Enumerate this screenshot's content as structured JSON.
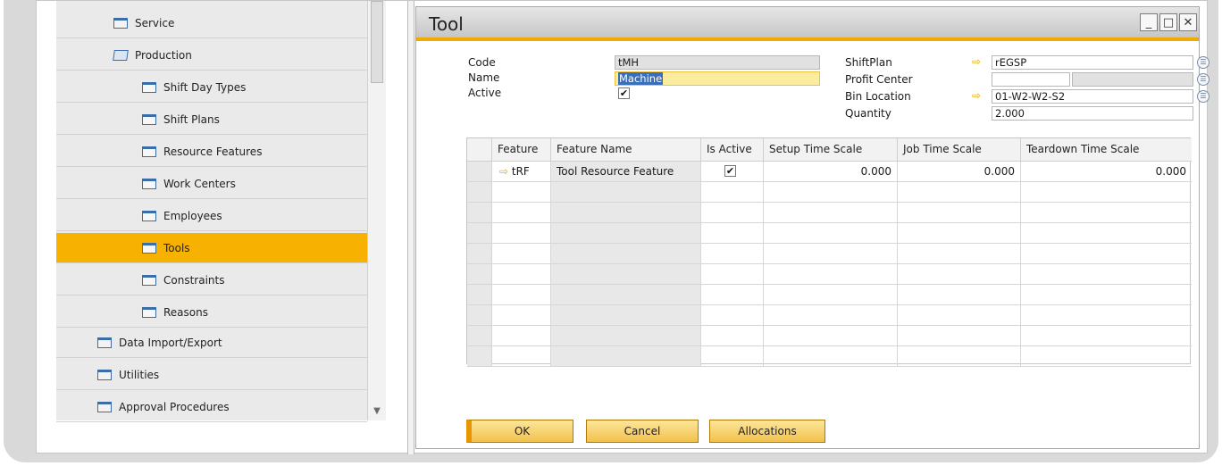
{
  "nav": {
    "items": [
      {
        "label": "Service",
        "icon": "folder-icon",
        "indent": 1,
        "selected": false
      },
      {
        "label": "Production",
        "icon": "folder-open-icon",
        "indent": 1,
        "selected": false
      },
      {
        "label": "Shift Day Types",
        "icon": "window-icon",
        "indent": 2,
        "selected": false
      },
      {
        "label": "Shift Plans",
        "icon": "window-icon",
        "indent": 2,
        "selected": false
      },
      {
        "label": "Resource Features",
        "icon": "window-icon",
        "indent": 2,
        "selected": false
      },
      {
        "label": "Work Centers",
        "icon": "window-icon",
        "indent": 2,
        "selected": false
      },
      {
        "label": "Employees",
        "icon": "window-icon",
        "indent": 2,
        "selected": false
      },
      {
        "label": "Tools",
        "icon": "window-icon",
        "indent": 2,
        "selected": true
      },
      {
        "label": "Constraints",
        "icon": "window-icon",
        "indent": 2,
        "selected": false
      },
      {
        "label": "Reasons",
        "icon": "window-icon",
        "indent": 2,
        "selected": false
      },
      {
        "label": "Data Import/Export",
        "icon": "folder-icon",
        "indent": 0,
        "selected": false
      },
      {
        "label": "Utilities",
        "icon": "folder-icon",
        "indent": 0,
        "selected": false
      },
      {
        "label": "Approval Procedures",
        "icon": "folder-icon",
        "indent": 0,
        "selected": false
      }
    ],
    "scroll_down_glyph": "▼"
  },
  "window": {
    "title": "Tool",
    "minimize_glyph": "_",
    "maximize_glyph": "□",
    "close_glyph": "✕"
  },
  "form": {
    "code_label": "Code",
    "code_value": "tMH",
    "name_label": "Name",
    "name_value": "Machine",
    "active_label": "Active",
    "active_checked": true,
    "shiftplan_label": "ShiftPlan",
    "shiftplan_value": "rEGSP",
    "profit_center_label": "Profit Center",
    "profit_center_value": "",
    "profit_center_desc": "",
    "bin_location_label": "Bin Location",
    "bin_location_value": "01-W2-W2-S2",
    "quantity_label": "Quantity",
    "quantity_value": "2.000",
    "link_arrow": "⇨",
    "list_glyph": "☰",
    "check_glyph": "✔"
  },
  "grid": {
    "columns": [
      "",
      "Feature",
      "Feature Name",
      "Is Active",
      "Setup Time Scale",
      "Job Time Scale",
      "Teardown Time Scale"
    ],
    "rows": [
      {
        "feature": "tRF",
        "feature_name": "Tool Resource Feature",
        "is_active": true,
        "setup": "0.000",
        "job": "0.000",
        "teardown": "0.000"
      }
    ],
    "empty_rows": 9
  },
  "buttons": {
    "ok": "OK",
    "cancel": "Cancel",
    "allocations": "Allocations"
  },
  "colors": {
    "accent": "#f7b100",
    "selected_nav": "#f7b100",
    "title_underline": "#f0aa00"
  }
}
